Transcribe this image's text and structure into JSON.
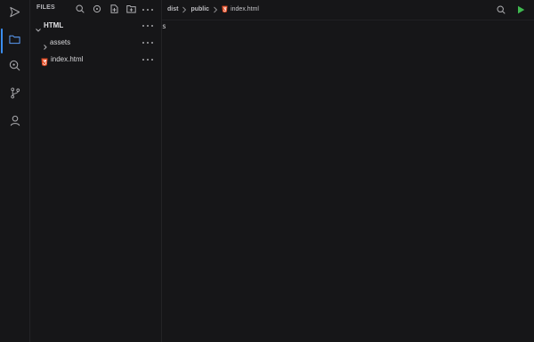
{
  "activity_bar": {
    "items": [
      {
        "icon": "play-icon",
        "active": false
      },
      {
        "icon": "folder-icon",
        "active": true
      },
      {
        "icon": "search-icon",
        "active": false
      },
      {
        "icon": "git-branch-icon",
        "active": false
      },
      {
        "icon": "user-icon",
        "active": false
      }
    ],
    "accent": "#3b8ef0"
  },
  "sidebar": {
    "title": "FILES",
    "tools": [
      "search-icon",
      "location-icon",
      "new-file-icon",
      "new-folder-icon",
      "more-icon"
    ],
    "tree": {
      "root": {
        "label": "HTML",
        "expanded": true
      },
      "items": [
        {
          "label": "assets",
          "type": "folder",
          "expanded": false
        },
        {
          "label": "index.html",
          "type": "file",
          "icon": "html5-icon"
        }
      ]
    }
  },
  "editor": {
    "breadcrumb": [
      "dist",
      "public",
      "index.html"
    ],
    "code": "s",
    "actions": [
      "search-icon",
      "run-icon"
    ],
    "run_color": "#3fb950",
    "html_icon_color": "#e44d26"
  }
}
